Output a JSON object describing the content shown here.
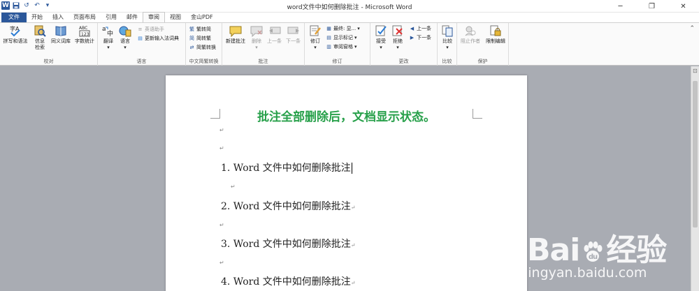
{
  "window": {
    "title": "word文件中如何删除批注 - Microsoft Word"
  },
  "tabs": [
    {
      "label": "文件"
    },
    {
      "label": "开始"
    },
    {
      "label": "插入"
    },
    {
      "label": "页面布局"
    },
    {
      "label": "引用"
    },
    {
      "label": "邮件"
    },
    {
      "label": "审阅"
    },
    {
      "label": "视图"
    },
    {
      "label": "金山PDF"
    }
  ],
  "ribbon": {
    "proofing": {
      "label": "校对",
      "spell": "拼写和语法",
      "research_1": "信息",
      "research_2": "检索",
      "thesaurus": "同义词库",
      "wordcount": "字数统计"
    },
    "language": {
      "label": "语言",
      "translate": "翻译",
      "language": "语言",
      "english_assistant": "英语助手",
      "update_ime": "更新输入法词典"
    },
    "chinese": {
      "label": "中文简繁转换",
      "to_simplified": "繁转简",
      "to_traditional": "简转繁",
      "convert": "简繁转换"
    },
    "comments": {
      "label": "批注",
      "new": "新建批注",
      "delete": "删除",
      "prev": "上一条",
      "next": "下一条"
    },
    "tracking": {
      "label": "修订",
      "track": "修订",
      "final_display": "最终: 显...",
      "show_markup": "显示标记",
      "reviewing_pane": "审阅窗格"
    },
    "changes": {
      "label": "更改",
      "accept": "接受",
      "reject": "拒绝",
      "prev": "上一条",
      "next": "下一条"
    },
    "compare": {
      "label": "比较",
      "compare": "比较"
    },
    "protect": {
      "label": "保护",
      "block_authors": "阻止作者",
      "restrict": "限制编辑"
    }
  },
  "document": {
    "heading": "批注全部删除后，文档显示状态。",
    "para_mark": "↵",
    "lines": [
      "1. Word 文件中如何删除批注",
      "2. Word 文件中如何删除批注",
      "3. Word 文件中如何删除批注",
      "4. Word 文件中如何删除批注"
    ]
  },
  "watermark": {
    "brand_left": "Bai",
    "brand_right": "经验",
    "url": "jingyan.baidu.com"
  },
  "colors": {
    "accent": "#2b579a",
    "heading": "#27a04a"
  }
}
